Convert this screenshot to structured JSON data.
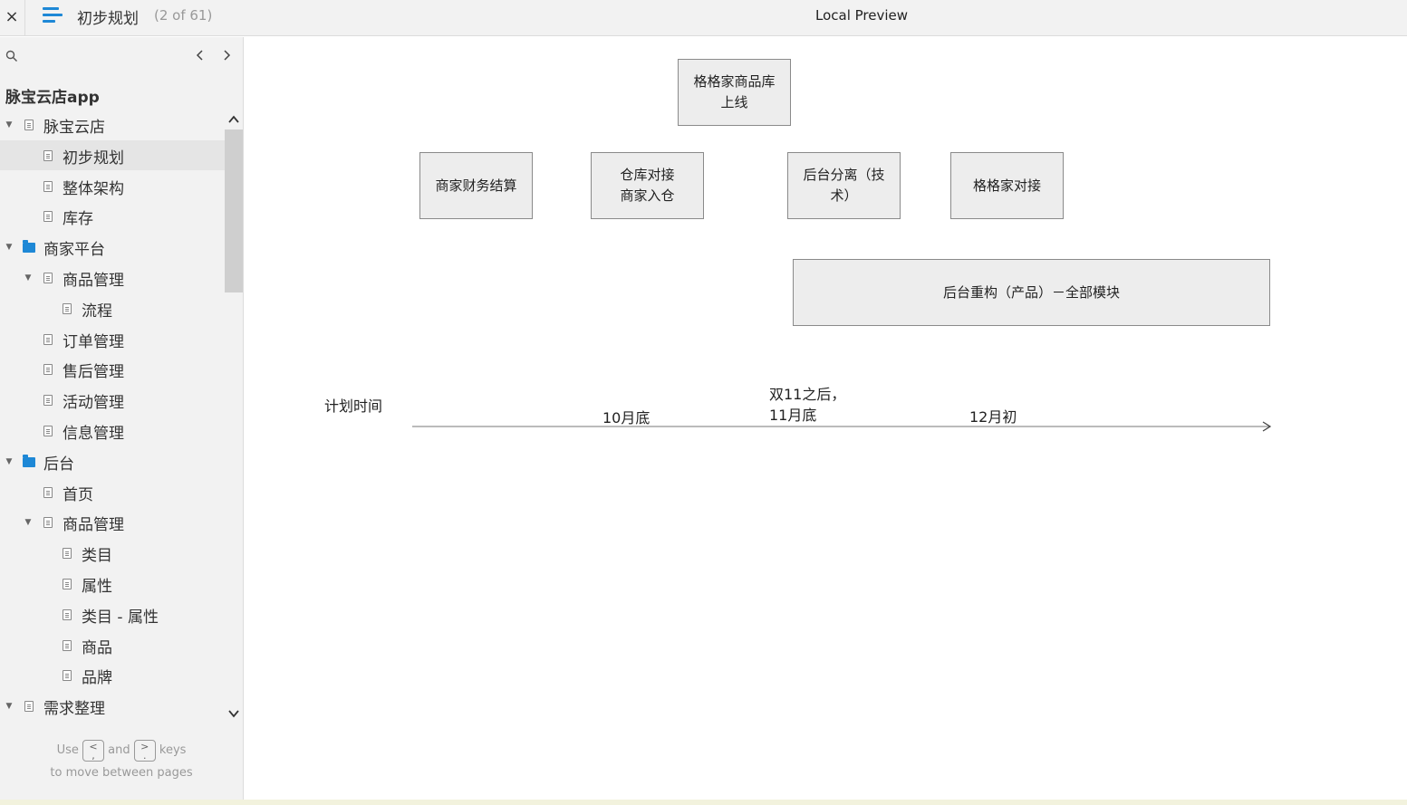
{
  "topbar": {
    "close": "×",
    "page_title": "初步规划",
    "page_count": "(2 of 61)",
    "app_title": "Local Preview"
  },
  "sidebar": {
    "book_title": "脉宝云店app",
    "items": [
      {
        "label": "脉宝云店",
        "type": "doc",
        "level": 0,
        "expanded": true
      },
      {
        "label": "初步规划",
        "type": "doc",
        "level": 1,
        "selected": true
      },
      {
        "label": "整体架构",
        "type": "doc",
        "level": 1
      },
      {
        "label": "库存",
        "type": "doc",
        "level": 1
      },
      {
        "label": "商家平台",
        "type": "folder",
        "level": 0,
        "expanded": true
      },
      {
        "label": "商品管理",
        "type": "doc",
        "level": 1,
        "expanded": true
      },
      {
        "label": "流程",
        "type": "doc",
        "level": 2
      },
      {
        "label": "订单管理",
        "type": "doc",
        "level": 1
      },
      {
        "label": "售后管理",
        "type": "doc",
        "level": 1
      },
      {
        "label": "活动管理",
        "type": "doc",
        "level": 1
      },
      {
        "label": "信息管理",
        "type": "doc",
        "level": 1
      },
      {
        "label": "后台",
        "type": "folder",
        "level": 0,
        "expanded": true
      },
      {
        "label": "首页",
        "type": "doc",
        "level": 1
      },
      {
        "label": "商品管理",
        "type": "doc",
        "level": 1,
        "expanded": true
      },
      {
        "label": "类目",
        "type": "doc",
        "level": 2
      },
      {
        "label": "属性",
        "type": "doc",
        "level": 2
      },
      {
        "label": "类目 - 属性",
        "type": "doc",
        "level": 2
      },
      {
        "label": "商品",
        "type": "doc",
        "level": 2
      },
      {
        "label": "品牌",
        "type": "doc",
        "level": 2
      },
      {
        "label": "需求整理",
        "type": "doc",
        "level": 0,
        "expanded": true
      }
    ],
    "hint": {
      "use": "Use",
      "key1": "<\n,",
      "and": "and",
      "key2": ">\n.",
      "keys": "keys",
      "line2": "to move between pages"
    }
  },
  "diagram": {
    "boxes": [
      {
        "id": "box-gegejia-library",
        "text": "格格家商品库\n上线"
      },
      {
        "id": "box-merchant-settlement",
        "text": "商家财务结算"
      },
      {
        "id": "box-warehouse",
        "text": "仓库对接\n  商家入仓"
      },
      {
        "id": "box-backend-split",
        "text": "后台分离（技\n术）"
      },
      {
        "id": "box-gegejia-docking",
        "text": "格格家对接"
      },
      {
        "id": "box-backend-rebuild",
        "text": "后台重构（产品）－全部模块"
      }
    ],
    "timeline": {
      "label": "计划时间",
      "marks": [
        "10月底",
        "双11之后，\n11月底",
        "12月初"
      ]
    }
  }
}
